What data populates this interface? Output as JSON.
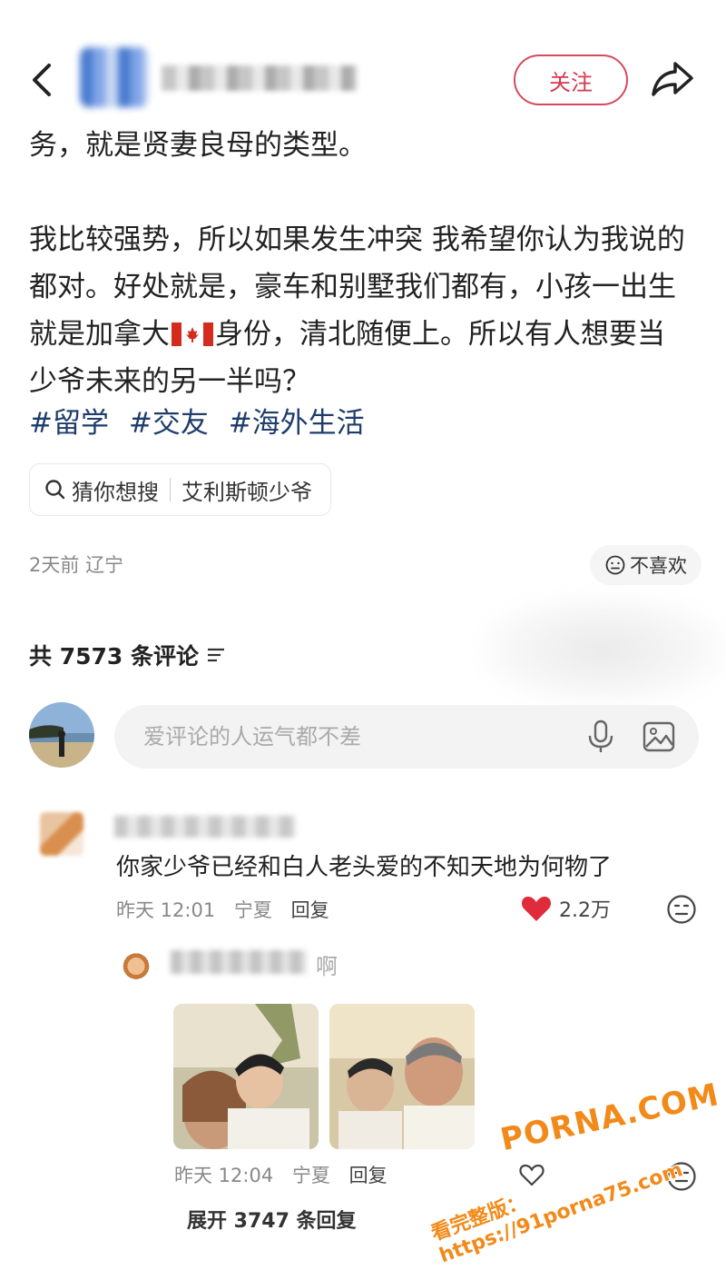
{
  "header": {
    "follow_label": "关注"
  },
  "post": {
    "line1": "务，就是贤妻良母的类型。",
    "para2_line1": "我比较强势，所以如果发生冲突 我希望你认为我说的",
    "para2_line2": "都对。好处就是，豪车和别墅我们都有，小孩一出生",
    "para2_line3a": "就是加拿大",
    "para2_line3b": "身份，清北随便上。所以有人想要当",
    "para2_line4": "少爷未来的另一半吗？",
    "tags": [
      "#留学",
      "#交友",
      "#海外生活"
    ]
  },
  "search_suggestion": {
    "prefix": "猜你想搜",
    "term": "艾利斯顿少爷"
  },
  "meta": {
    "time": "2天前",
    "location": "辽宁",
    "dislike_label": "不喜欢"
  },
  "comments_header": {
    "count_label": "共 7573 条评论"
  },
  "comment_input": {
    "placeholder": "爱评论的人运气都不差"
  },
  "comment1": {
    "text": "你家少爷已经和白人老头爱的不知天地为何物了",
    "time": "昨天 12:01",
    "location": "宁夏",
    "reply_label": "回复",
    "like_count": "2.2万"
  },
  "reply1": {
    "text_visible": "啊",
    "time": "昨天 12:04",
    "location": "宁夏",
    "reply_label": "回复"
  },
  "expand": {
    "label": "展开 3747 条回复"
  },
  "watermark": {
    "line1": "PORNA.COM",
    "line2": "看完整版：https://91porna75.com"
  },
  "colors": {
    "accent": "#d33a4f",
    "tag": "#1f3d6b",
    "like": "#e02c3a",
    "watermark": "#f28a1a"
  }
}
